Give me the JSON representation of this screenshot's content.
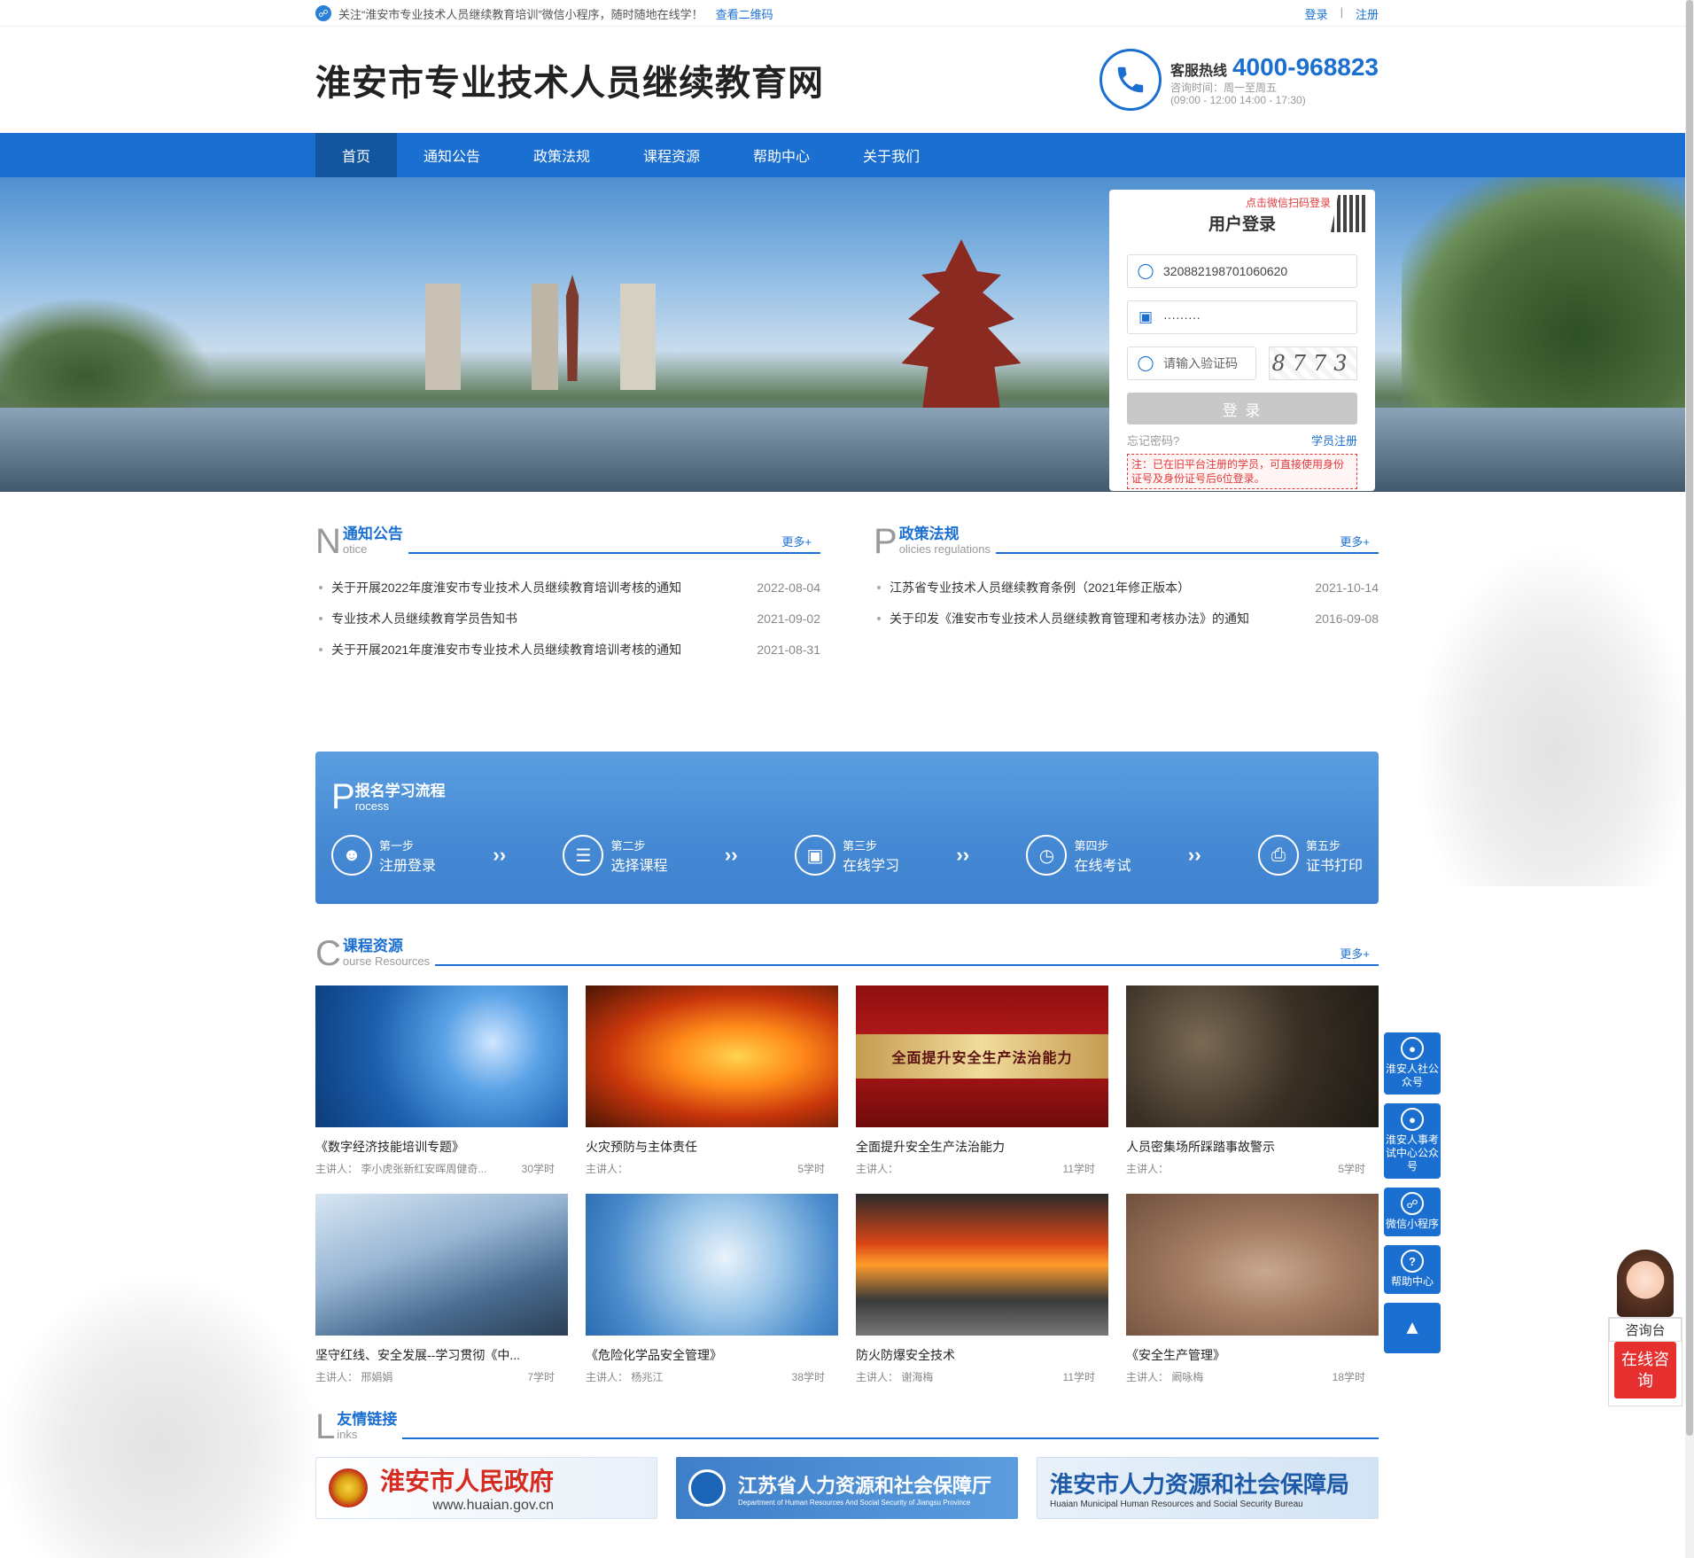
{
  "topbar": {
    "notice": "关注“淮安市专业技术人员继续教育培训”微信小程序，随时随地在线学！",
    "qr_link": "查看二维码",
    "login": "登录",
    "separator": "|",
    "register": "注册"
  },
  "header": {
    "title": "淮安市专业技术人员继续教育网",
    "hotline_label": "客服热线",
    "hotline_number": "4000-968823",
    "hours_line1": "咨询时间：周一至周五",
    "hours_line2": "(09:00 - 12:00 14:00 - 17:30)"
  },
  "nav": [
    "首页",
    "通知公告",
    "政策法规",
    "课程资源",
    "帮助中心",
    "关于我们"
  ],
  "login_box": {
    "scan_hint": "点击微信扫码登录",
    "title": "用户登录",
    "username_value": "320882198701060620",
    "password_value": "·········",
    "captcha_placeholder": "请输入验证码",
    "captcha_code": "8773",
    "button": "登 录",
    "forgot": "忘记密码?",
    "register": "学员注册",
    "note": "注：已在旧平台注册的学员，可直接使用身份证号及身份证号后6位登录。"
  },
  "notices": {
    "big": "N",
    "title": "通知公告",
    "en": "otice",
    "more": "更多+",
    "items": [
      {
        "text": "关于开展2022年度淮安市专业技术人员继续教育培训考核的通知",
        "date": "2022-08-04"
      },
      {
        "text": "专业技术人员继续教育学员告知书",
        "date": "2021-09-02"
      },
      {
        "text": "关于开展2021年度淮安市专业技术人员继续教育培训考核的通知",
        "date": "2021-08-31"
      }
    ]
  },
  "policies": {
    "big": "P",
    "title": "政策法规",
    "en": "olicies regulations",
    "more": "更多+",
    "items": [
      {
        "text": "江苏省专业技术人员继续教育条例（2021年修正版本）",
        "date": "2021-10-14"
      },
      {
        "text": "关于印发《淮安市专业技术人员继续教育管理和考核办法》的通知",
        "date": "2016-09-08"
      }
    ]
  },
  "process": {
    "big": "P",
    "title": "报名学习流程",
    "en": "rocess",
    "steps": [
      {
        "step": "第一步",
        "label": "注册登录"
      },
      {
        "step": "第二步",
        "label": "选择课程"
      },
      {
        "step": "第三步",
        "label": "在线学习"
      },
      {
        "step": "第四步",
        "label": "在线考试"
      },
      {
        "step": "第五步",
        "label": "证书打印"
      }
    ]
  },
  "courses": {
    "big": "C",
    "title": "课程资源",
    "en": "ourse Resources",
    "more": "更多+",
    "items": [
      {
        "title": "《数字经济技能培训专题》",
        "tutor": "主讲人：  李小虎张新红安晖周健奇...",
        "hours": "30学时"
      },
      {
        "title": "火灾预防与主体责任",
        "tutor": "主讲人：",
        "hours": "5学时"
      },
      {
        "title": "全面提升安全生产法治能力",
        "tutor": "主讲人：",
        "hours": "11学时",
        "banner": "全面提升安全生产法治能力"
      },
      {
        "title": "人员密集场所踩踏事故警示",
        "tutor": "主讲人：",
        "hours": "5学时"
      },
      {
        "title": "坚守红线、安全发展--学习贯彻《中...",
        "tutor": "主讲人：  邢娟娟",
        "hours": "7学时"
      },
      {
        "title": "《危险化学品安全管理》",
        "tutor": "主讲人：  杨兆江",
        "hours": "38学时"
      },
      {
        "title": "防火防爆安全技术",
        "tutor": "主讲人：  谢海梅",
        "hours": "11学时"
      },
      {
        "title": "《安全生产管理》",
        "tutor": "主讲人：  阚咏梅",
        "hours": "18学时"
      }
    ]
  },
  "links": {
    "big": "L",
    "title": "友情链接",
    "en": "inks",
    "items": [
      {
        "name": "淮安市人民政府",
        "sub": "www.huaian.gov.cn"
      },
      {
        "name": "江苏省人力资源和社会保障厅",
        "sub": "Department of Human Resources And Social Security of Jiangsu Province"
      },
      {
        "name": "淮安市人力资源和社会保障局",
        "sub": "Huaian Municipal Human Resources and Social Security Bureau"
      }
    ]
  },
  "float_bar": {
    "items": [
      "淮安人社公众号",
      "淮安人事考试中心公众号",
      "微信小程序",
      "帮助中心"
    ]
  },
  "consult": {
    "label": "咨询台",
    "button": "在线咨询"
  },
  "colors": {
    "primary": "#1a6fd1",
    "nav_active": "#12569f",
    "accent_red": "#e03a3a"
  }
}
